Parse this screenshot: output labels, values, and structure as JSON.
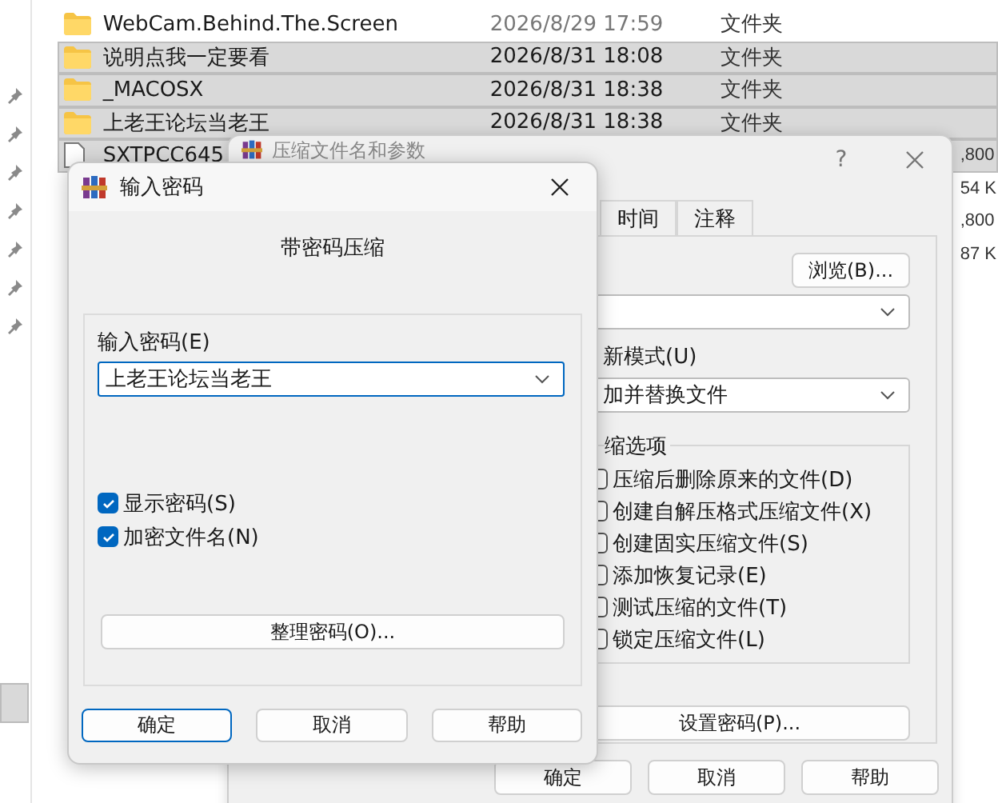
{
  "explorer": {
    "rows": [
      {
        "kind": "folder",
        "name": "WebCam.Behind.The.Screen",
        "modified": "2026/8/29 17:59",
        "type": "文件夹",
        "selected": false
      },
      {
        "kind": "folder",
        "name": "说明点我一定要看",
        "modified": "2026/8/31 18:08",
        "type": "文件夹",
        "selected": true
      },
      {
        "kind": "folder",
        "name": "_MACOSX",
        "modified": "2026/8/31 18:38",
        "type": "文件夹",
        "selected": true
      },
      {
        "kind": "folder",
        "name": "上老王论坛当老王",
        "modified": "2026/8/31 18:38",
        "type": "文件夹",
        "selected": true
      },
      {
        "kind": "file",
        "name": "SXTPCC645",
        "size": ",800",
        "selected": true
      },
      {
        "kind": "hidden",
        "size": "54 K"
      },
      {
        "kind": "hidden",
        "size": ",800"
      },
      {
        "kind": "hidden",
        "size": "87 K"
      }
    ]
  },
  "archive_dialog": {
    "title": "压缩文件名和参数",
    "help": "?",
    "tabs": [
      {
        "label": "时间",
        "selected": false
      },
      {
        "label": "注释",
        "selected": false
      }
    ],
    "browse_button": "浏览(B)...",
    "update_mode_label": "新模式(U)",
    "update_mode_value": "加并替换文件",
    "options_title": "缩选项",
    "options": [
      {
        "label": "压缩后删除原来的文件(D)",
        "checked": false
      },
      {
        "label": "创建自解压格式压缩文件(X)",
        "checked": false
      },
      {
        "label": "创建固实压缩文件(S)",
        "checked": false
      },
      {
        "label": "添加恢复记录(E)",
        "checked": false
      },
      {
        "label": "测试压缩的文件(T)",
        "checked": false
      },
      {
        "label": "锁定压缩文件(L)",
        "checked": false
      }
    ],
    "set_password_button": "设置密码(P)...",
    "buttons": [
      "确定",
      "取消",
      "帮助"
    ]
  },
  "password_dialog": {
    "title": "输入密码",
    "heading": "带密码压缩",
    "password_label": "输入密码(E)",
    "password_value": "上老王论坛当老王",
    "options": [
      {
        "label": "显示密码(S)",
        "checked": true
      },
      {
        "label": "加密文件名(N)",
        "checked": true
      }
    ],
    "organize_button": "整理密码(O)...",
    "buttons": [
      {
        "label": "确定",
        "default": true
      },
      {
        "label": "取消",
        "default": false
      },
      {
        "label": "帮助",
        "default": false
      }
    ]
  }
}
